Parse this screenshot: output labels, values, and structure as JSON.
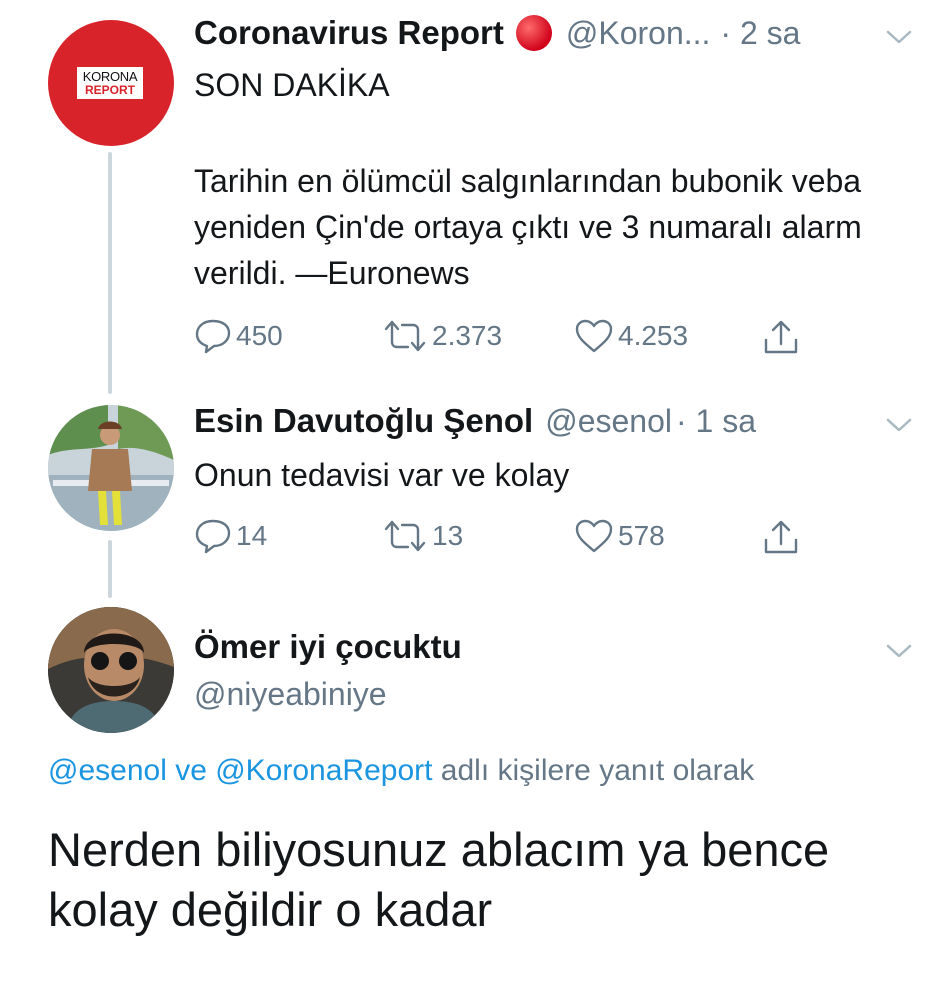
{
  "tweets": [
    {
      "name": "Coronavirus Report",
      "emoji": "🔴",
      "handle": "@Koron...",
      "time": "· 2 sa",
      "avatar_text": [
        "KORONA",
        "REPORT"
      ],
      "text_line1": "SON DAKİKA",
      "text_body": "Tarihin en ölümcül salgınlarından bubonik veba yeniden Çin'de ortaya çıktı ve 3 numaralı alarm verildi. —Euronews",
      "replies": "450",
      "retweets": "2.373",
      "likes": "4.253"
    },
    {
      "name": "Esin Davutoğlu Şenol",
      "handle": "@esenol",
      "time": "· 1 sa",
      "text": "Onun tedavisi var ve kolay",
      "replies": "14",
      "retweets": "13",
      "likes": "578"
    }
  ],
  "reply": {
    "name": "Ömer iyi çocuktu",
    "handle": "@niyeabiniye",
    "context_mention1": "@esenol",
    "context_and": " ve ",
    "context_mention2": "@KoronaReport",
    "context_suffix": " adlı kişilere yanıt olarak",
    "text": "Nerden biliyosunuz ablacım ya bence kolay değildir o kadar"
  },
  "colors": {
    "link": "#1b95e0",
    "muted": "#657786",
    "korona_red": "#d8232a"
  }
}
